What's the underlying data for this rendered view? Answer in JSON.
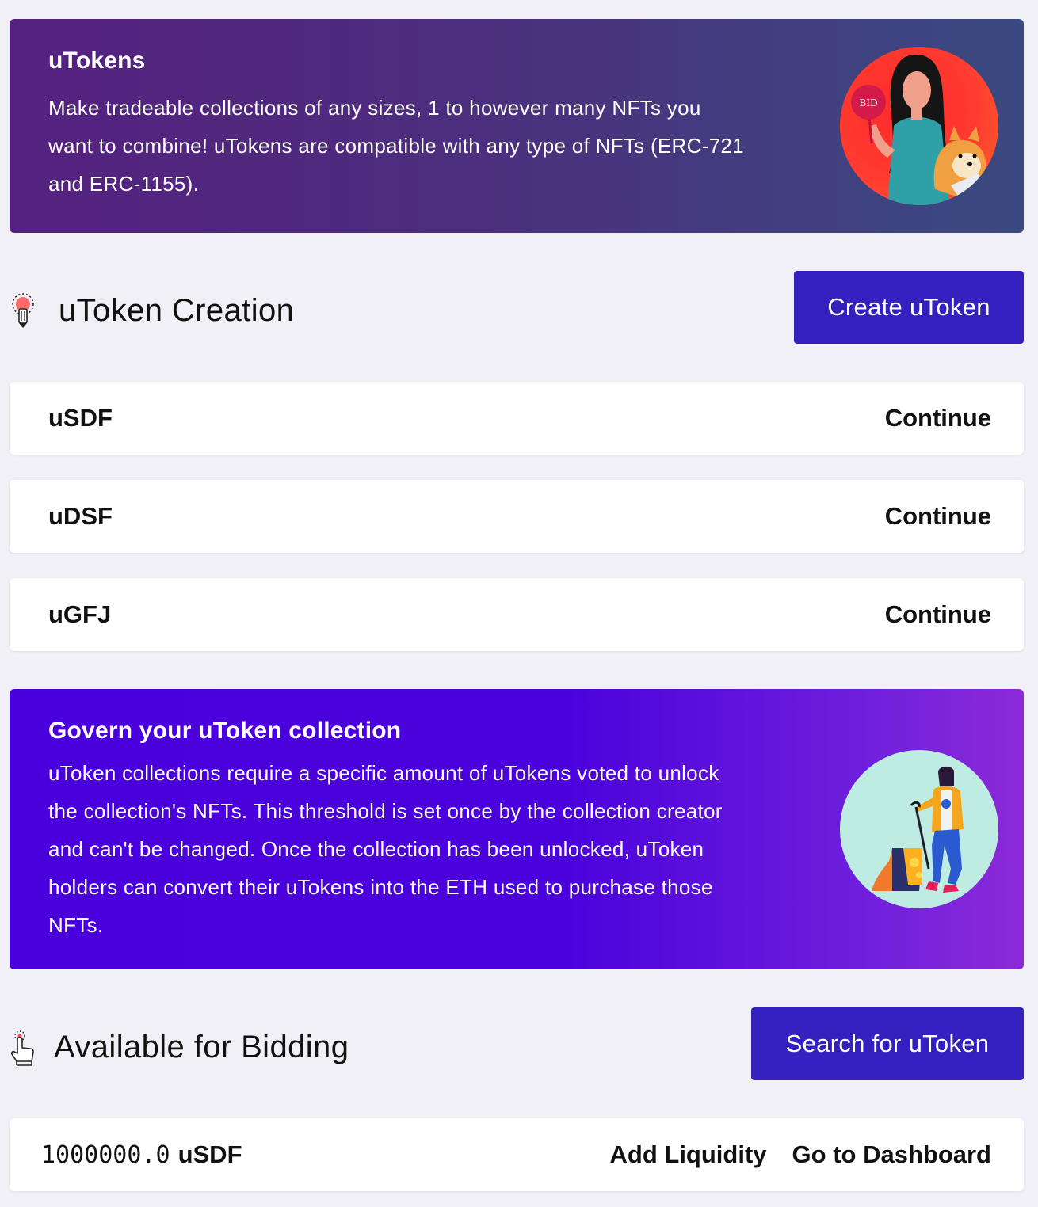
{
  "intro_banner": {
    "title": "uTokens",
    "body": "Make tradeable collections of any sizes, 1 to however many NFTs you want to combine! uTokens are compatible with any type of NFTs (ERC-721 and ERC-1155).",
    "illustration_badge": "BID"
  },
  "creation_section": {
    "icon": "lightbulb-pencil-icon",
    "title": "uToken Creation",
    "create_button": "Create uToken",
    "items": [
      {
        "name": "uSDF",
        "action": "Continue"
      },
      {
        "name": "uDSF",
        "action": "Continue"
      },
      {
        "name": "uGFJ",
        "action": "Continue"
      }
    ]
  },
  "govern_banner": {
    "title": "Govern your uToken collection",
    "body": "uToken collections require a specific amount of uTokens voted to unlock the collection's NFTs. This threshold is set once by the collection creator and can't be changed. Once the collection has been unlocked, uToken holders can convert their uTokens into the ETH used to purchase those NFTs."
  },
  "bidding_section": {
    "icon": "pointer-hand-icon",
    "title": "Available for Bidding",
    "search_button": "Search for uToken",
    "items": [
      {
        "amount": "1000000.0",
        "symbol": "uSDF",
        "add_liquidity": "Add Liquidity",
        "dashboard": "Go to Dashboard"
      }
    ]
  },
  "colors": {
    "primary_button": "#3420be",
    "background": "#f1f0f6"
  }
}
